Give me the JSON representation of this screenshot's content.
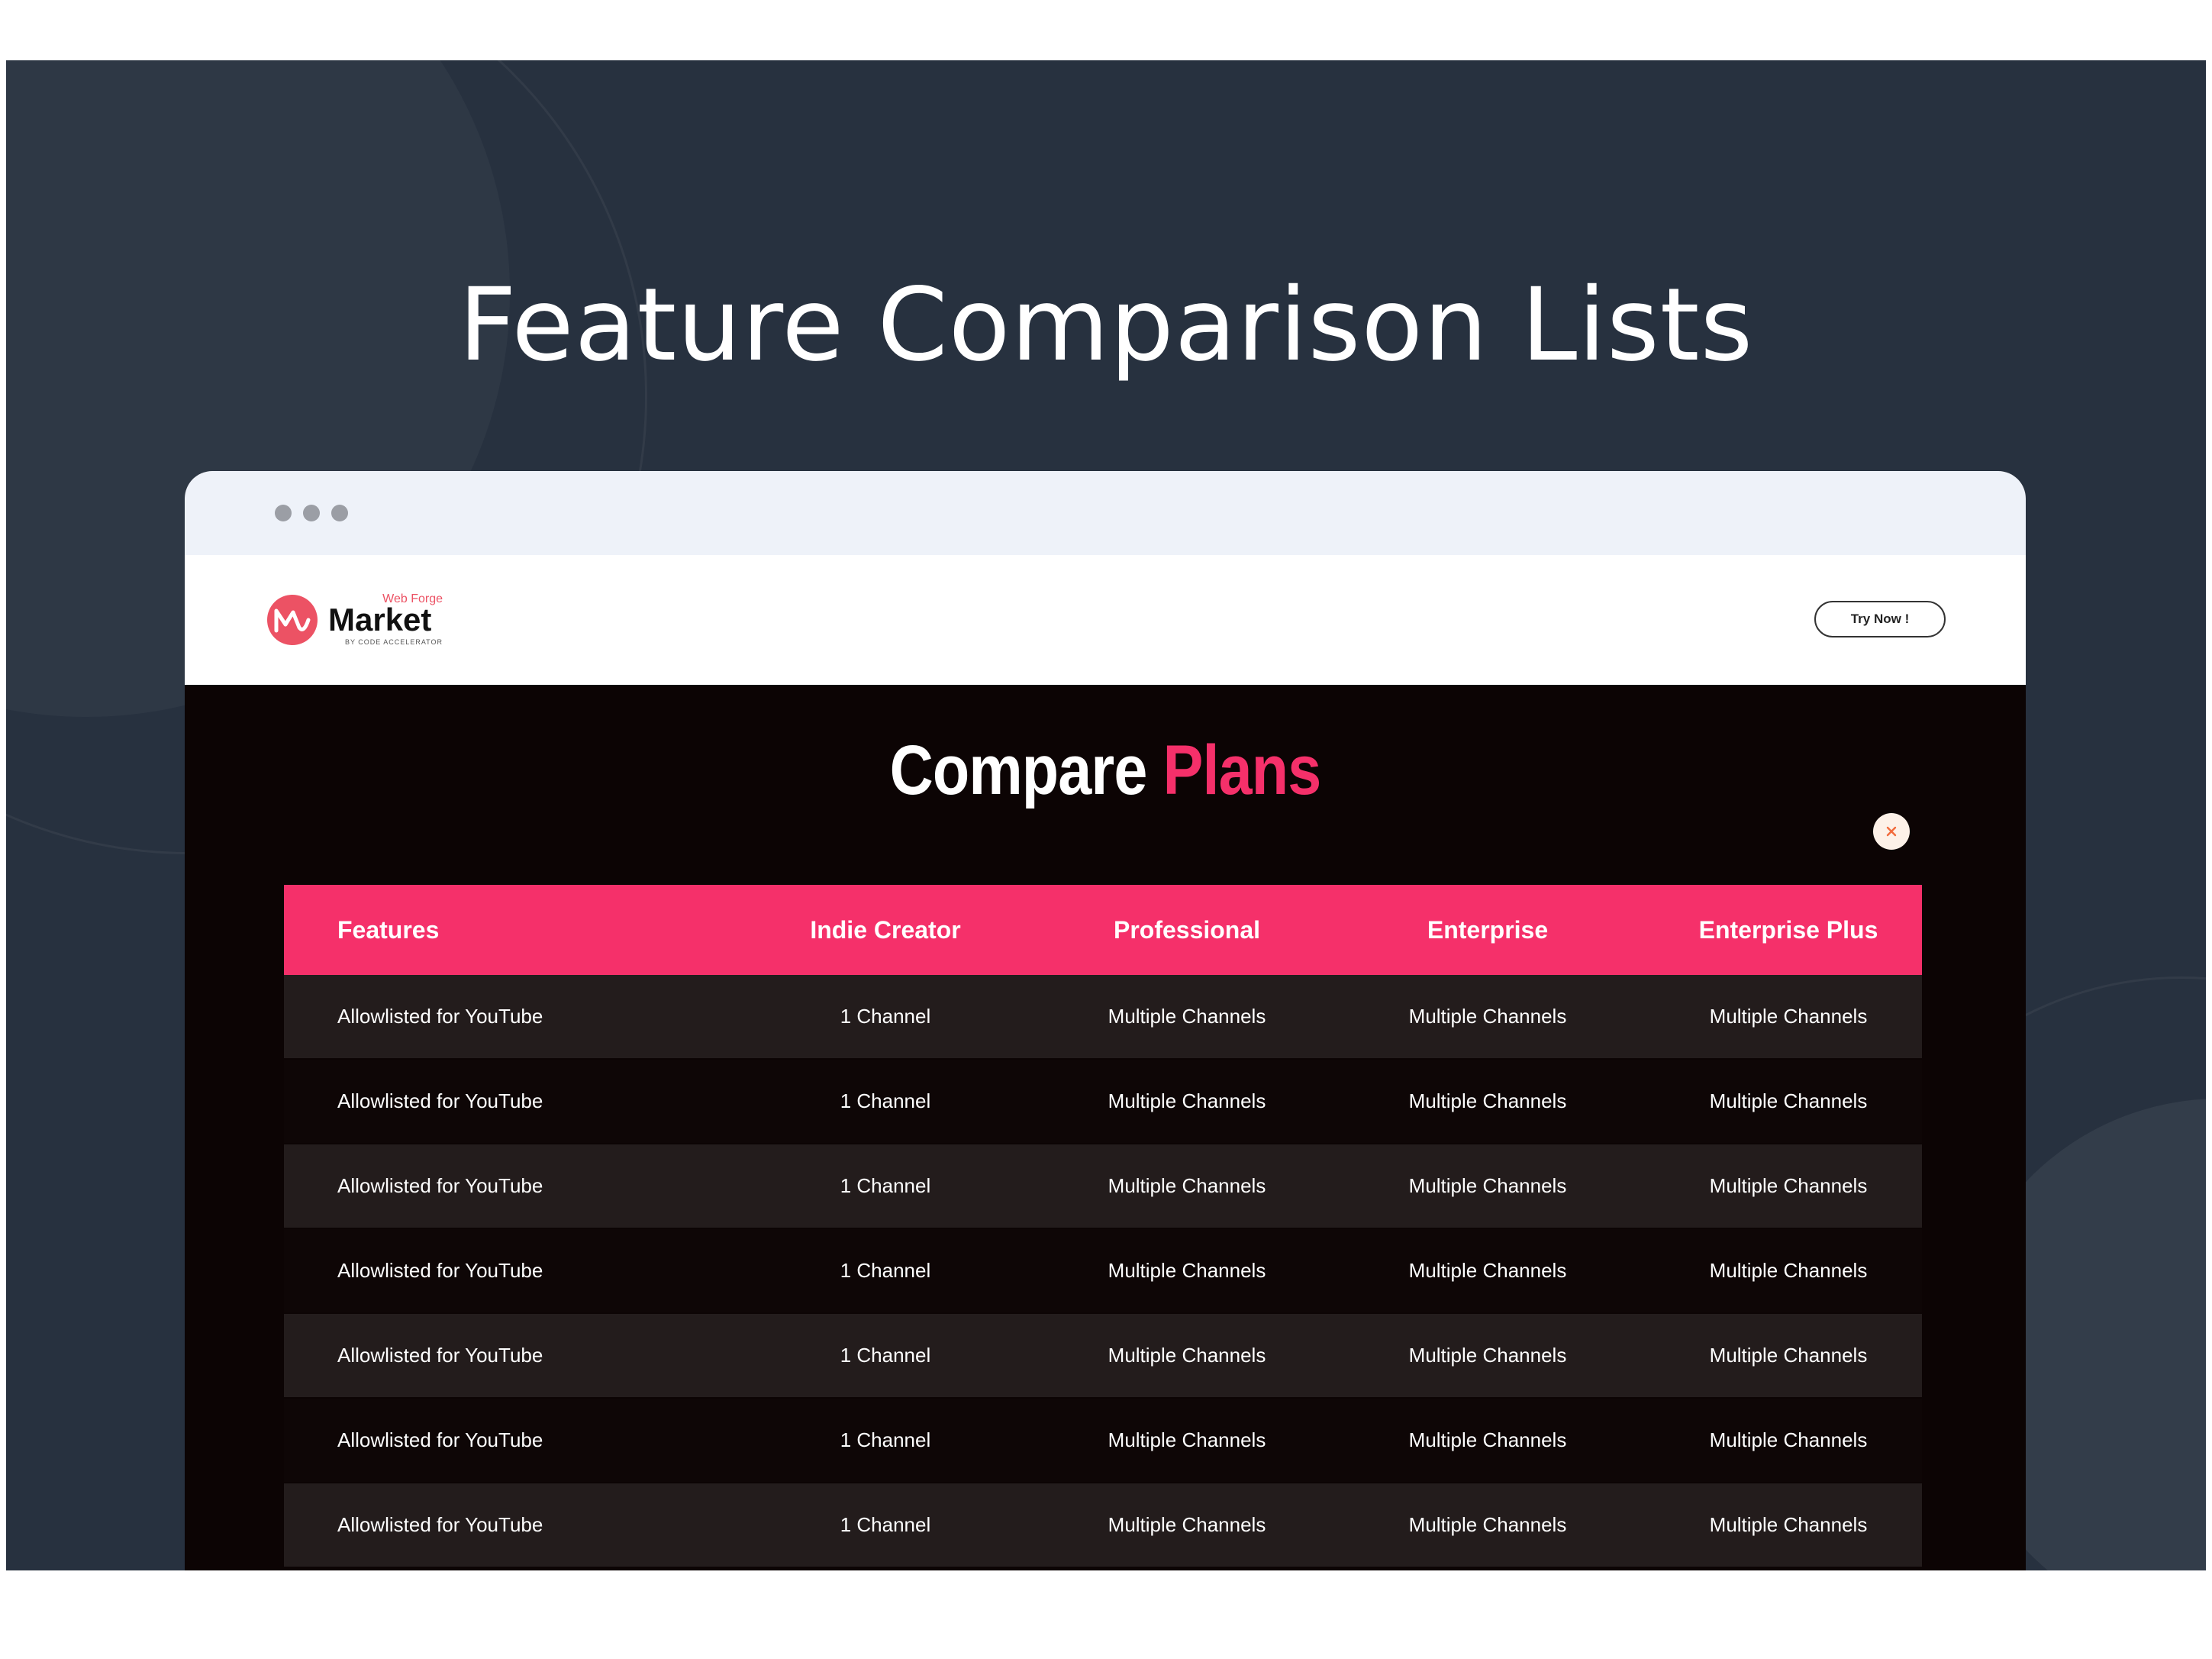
{
  "page": {
    "heading": "Feature Comparison Lists"
  },
  "site": {
    "logo_top": "Web Forge",
    "logo_main": "Market",
    "logo_sub": "BY CODE ACCELERATOR",
    "cta_label": "Try Now !"
  },
  "compare": {
    "title_main": "Compare",
    "title_accent": "Plans",
    "close_icon": "close-icon"
  },
  "colors": {
    "accent": "#f5306a",
    "panel_bg": "#27313f",
    "content_bg": "#0c0404",
    "row_odd": "#231c1c",
    "logo_red": "#ec5264"
  },
  "table": {
    "headers": [
      "Features",
      "Indie Creator",
      "Professional",
      "Enterprise",
      "Enterprise Plus"
    ],
    "rows": [
      [
        "Allowlisted for YouTube",
        "1 Channel",
        "Multiple Channels",
        "Multiple Channels",
        "Multiple Channels"
      ],
      [
        "Allowlisted for YouTube",
        "1 Channel",
        "Multiple Channels",
        "Multiple Channels",
        "Multiple Channels"
      ],
      [
        "Allowlisted for YouTube",
        "1 Channel",
        "Multiple Channels",
        "Multiple Channels",
        "Multiple Channels"
      ],
      [
        "Allowlisted for YouTube",
        "1 Channel",
        "Multiple Channels",
        "Multiple Channels",
        "Multiple Channels"
      ],
      [
        "Allowlisted for YouTube",
        "1 Channel",
        "Multiple Channels",
        "Multiple Channels",
        "Multiple Channels"
      ],
      [
        "Allowlisted for YouTube",
        "1 Channel",
        "Multiple Channels",
        "Multiple Channels",
        "Multiple Channels"
      ],
      [
        "Allowlisted for YouTube",
        "1 Channel",
        "Multiple Channels",
        "Multiple Channels",
        "Multiple Channels"
      ]
    ]
  }
}
